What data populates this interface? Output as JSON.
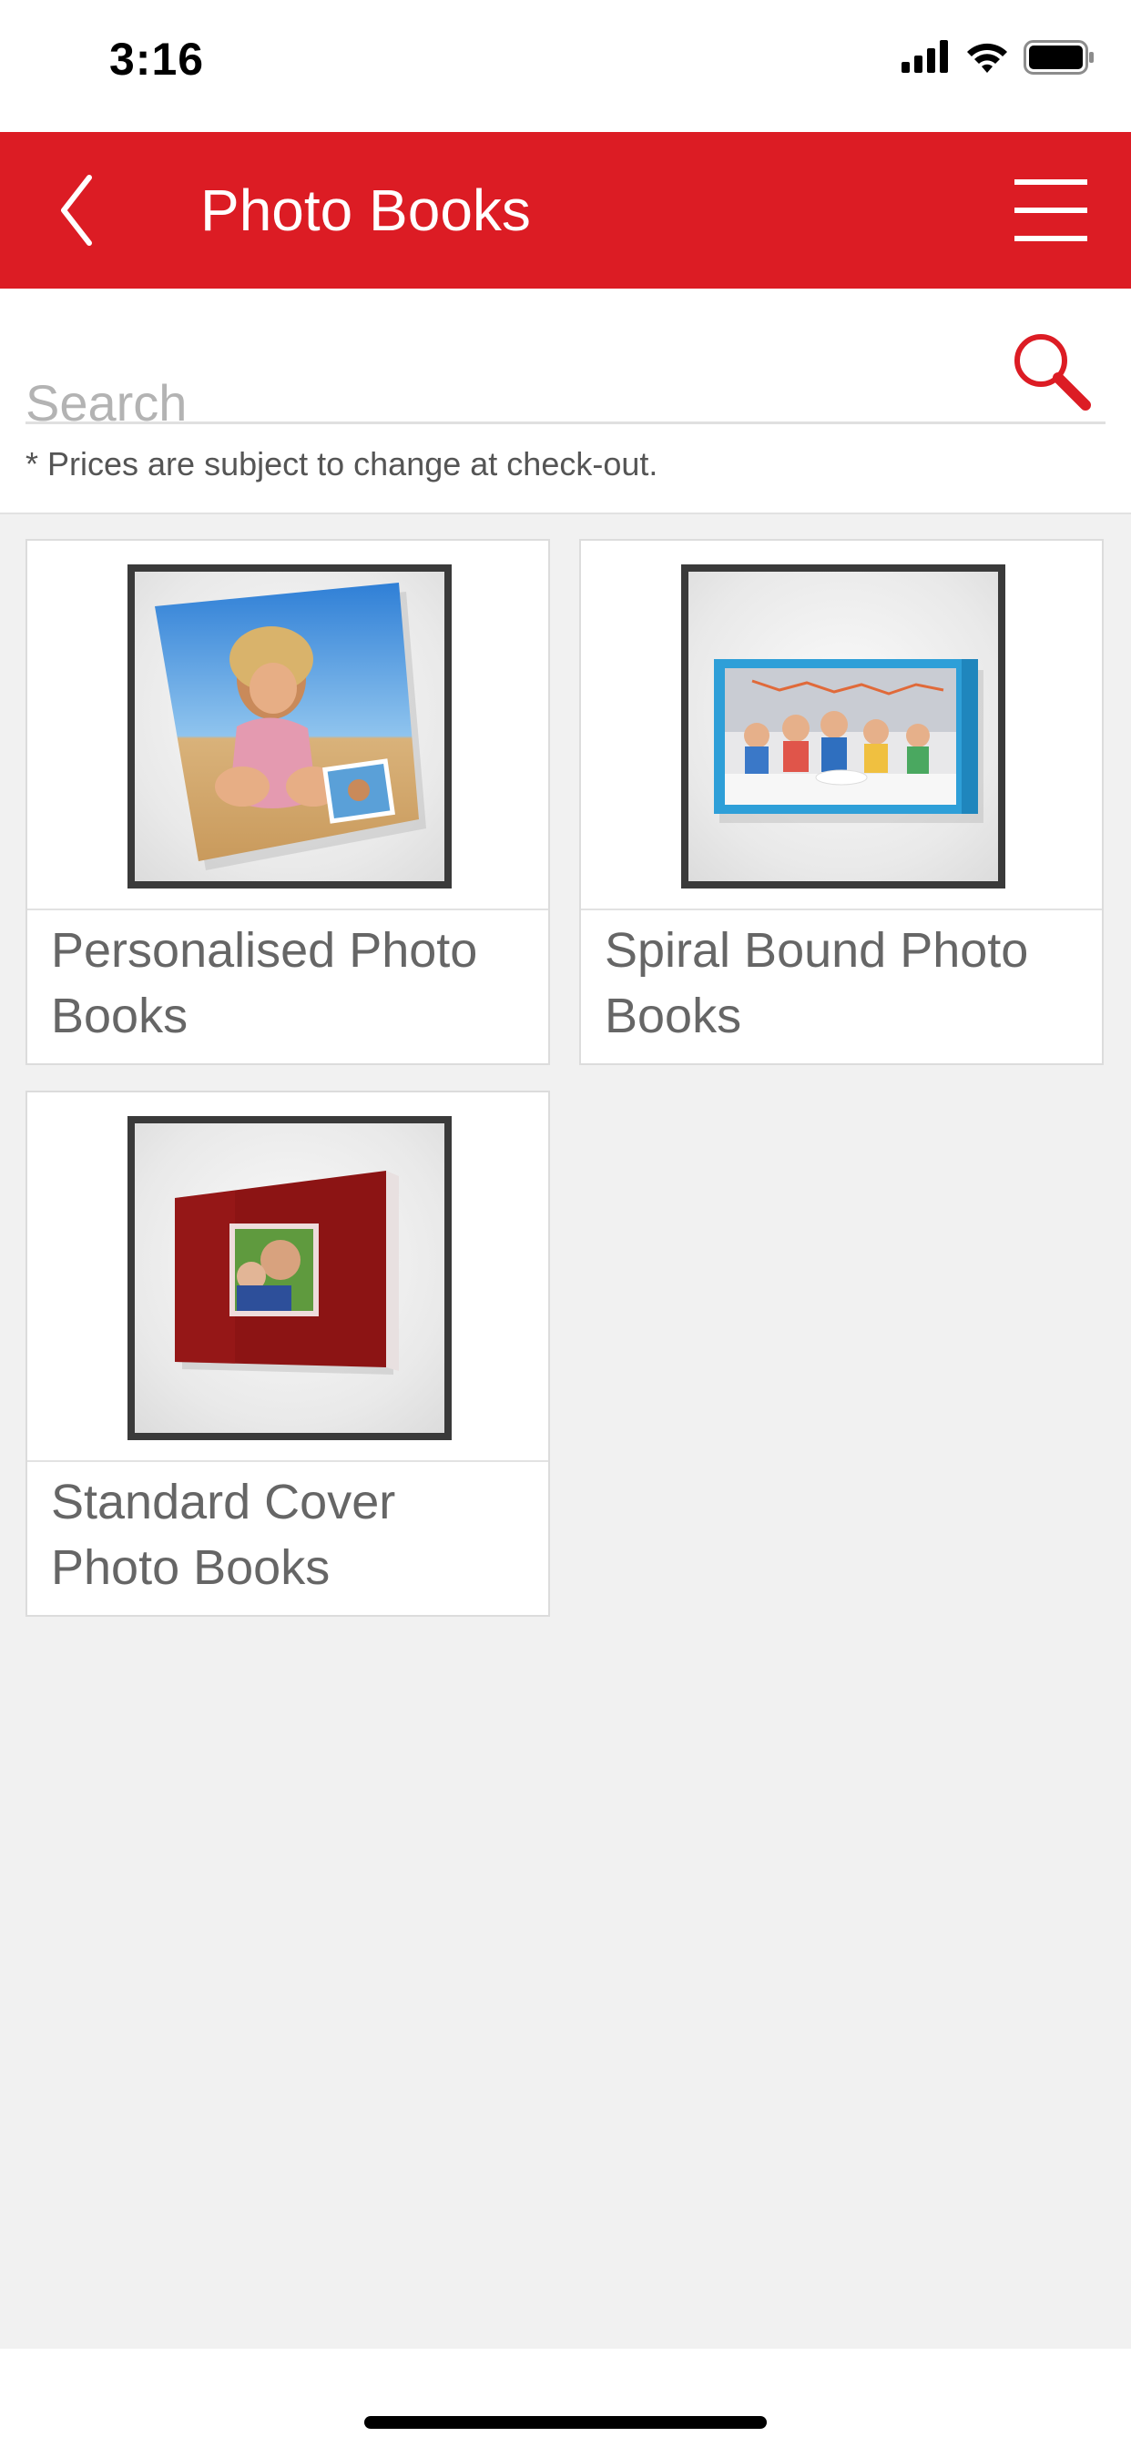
{
  "status_bar": {
    "time": "3:16",
    "icons": [
      "cellular-signal-icon",
      "wifi-icon",
      "battery-icon"
    ]
  },
  "header": {
    "title": "Photo Books",
    "back_icon": "chevron-left-icon",
    "menu_icon": "hamburger-menu-icon",
    "background_color": "#dc1c24"
  },
  "search": {
    "placeholder": "Search",
    "value": "",
    "icon": "search-icon",
    "icon_color": "#dc1c24"
  },
  "price_note": "* Prices are subject to change at check-out.",
  "products": [
    {
      "label": "Personalised Photo Books",
      "image": "girl-on-beach-photo-book-image"
    },
    {
      "label": "Spiral Bound Photo Books",
      "image": "kids-birthday-party-photo-book-image"
    },
    {
      "label": "Standard Cover Photo Books",
      "image": "red-cover-photo-book-image"
    }
  ]
}
